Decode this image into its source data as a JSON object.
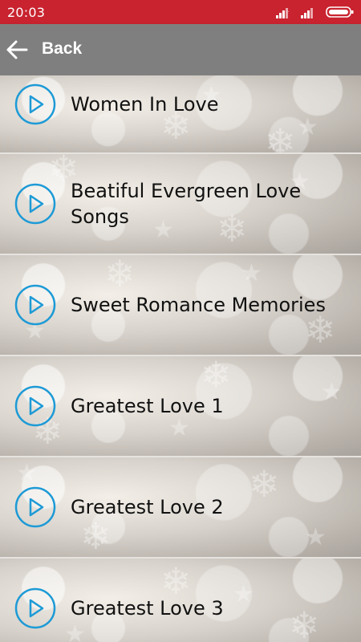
{
  "status_bar": {
    "time": "20:03",
    "icons": [
      "signal-icon",
      "signal-icon",
      "battery-icon"
    ],
    "color": "#c8232f"
  },
  "app_bar": {
    "back_label": "Back",
    "color": "#7f7f7f"
  },
  "playlist": {
    "items": [
      {
        "title": "Women In Love"
      },
      {
        "title": "Beatiful Evergreen Love Songs"
      },
      {
        "title": "Sweet Romance Memories"
      },
      {
        "title": "Greatest Love 1"
      },
      {
        "title": "Greatest Love 2"
      },
      {
        "title": "Greatest Love 3"
      }
    ],
    "play_icon_color": "#1d9ad6"
  }
}
